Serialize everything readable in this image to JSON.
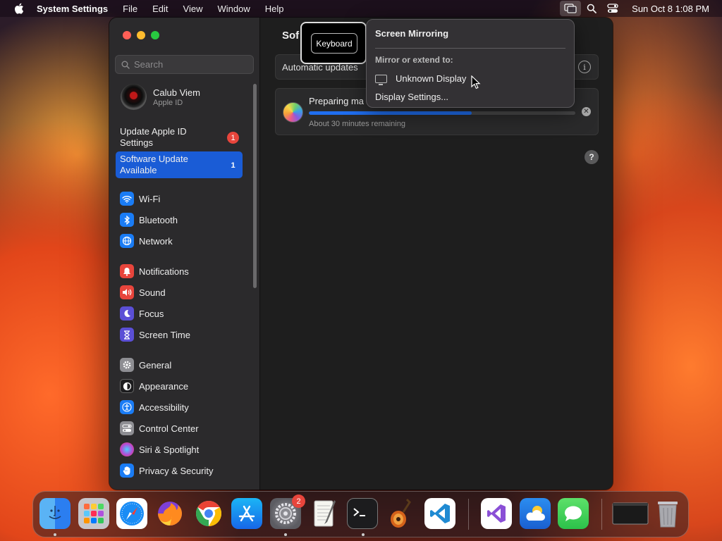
{
  "menubar": {
    "app_name": "System Settings",
    "menus": [
      "File",
      "Edit",
      "View",
      "Window",
      "Help"
    ],
    "clock": "Sun Oct 8  1:08 PM"
  },
  "sidebar": {
    "search_placeholder": "Search",
    "profile": {
      "name": "Calub Viem",
      "subtitle": "Apple ID"
    },
    "alerts": [
      {
        "label": "Update Apple ID Settings",
        "badge": "1"
      },
      {
        "label": "Software Update Available",
        "badge": "1"
      }
    ],
    "items": [
      {
        "label": "Wi-Fi",
        "icon": "wifi-icon",
        "color": "#1a7cf5"
      },
      {
        "label": "Bluetooth",
        "icon": "bluetooth-icon",
        "color": "#1a7cf5"
      },
      {
        "label": "Network",
        "icon": "globe-icon",
        "color": "#1a7cf5"
      },
      {
        "label": "Notifications",
        "icon": "bell-icon",
        "color": "#e8453c"
      },
      {
        "label": "Sound",
        "icon": "speaker-icon",
        "color": "#e8453c"
      },
      {
        "label": "Focus",
        "icon": "moon-icon",
        "color": "#5b4fd6"
      },
      {
        "label": "Screen Time",
        "icon": "hourglass-icon",
        "color": "#5b4fd6"
      },
      {
        "label": "General",
        "icon": "gear-icon",
        "color": "#8e8e93"
      },
      {
        "label": "Appearance",
        "icon": "appearance-icon",
        "color": "#1c1c1e"
      },
      {
        "label": "Accessibility",
        "icon": "accessibility-icon",
        "color": "#1a7cf5"
      },
      {
        "label": "Control Center",
        "icon": "toggles-icon",
        "color": "#8e8e93"
      },
      {
        "label": "Siri & Spotlight",
        "icon": "siri-icon",
        "color": "#b44bd6"
      },
      {
        "label": "Privacy & Security",
        "icon": "hand-icon",
        "color": "#1a7cf5"
      }
    ]
  },
  "main": {
    "title_fragment": "Sof",
    "automatic_updates_label": "Automatic updates",
    "update": {
      "title": "Preparing ma",
      "progress": 0.61,
      "remaining": "About 30 minutes remaining"
    },
    "help_label": "?",
    "info_label": "i"
  },
  "keyboard_popup": {
    "label": "Keyboard"
  },
  "screen_mirroring": {
    "title": "Screen Mirroring",
    "subtitle": "Mirror or extend to:",
    "display": "Unknown Display",
    "settings": "Display Settings..."
  },
  "dock": {
    "system_settings_badge": "2",
    "apps": [
      "Finder",
      "Launchpad",
      "Safari",
      "Firefox",
      "Chrome",
      "App Store",
      "System Settings",
      "TextEdit",
      "Terminal",
      "GarageBand",
      "VS Code",
      "Visual Studio",
      "Weather",
      "Messages",
      "Screen",
      "Trash"
    ]
  }
}
